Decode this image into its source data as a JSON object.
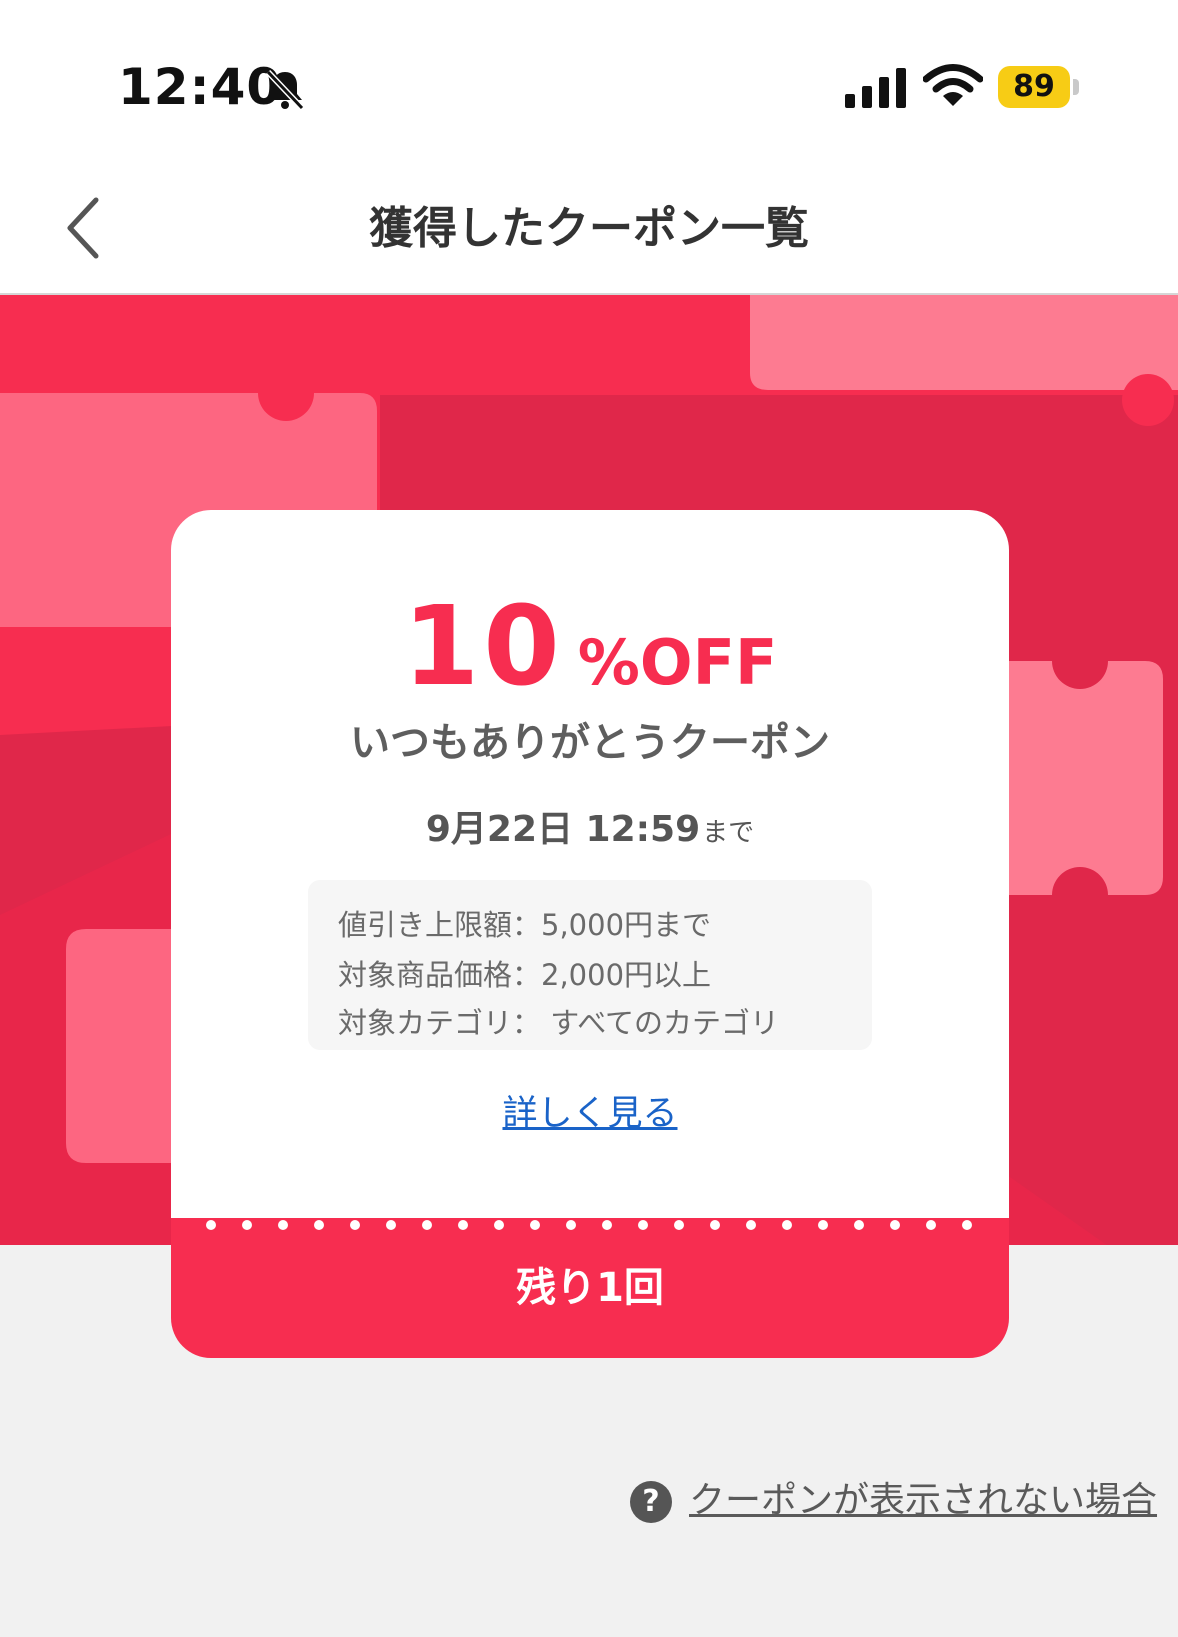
{
  "status_bar": {
    "time": "12:40",
    "battery": "89",
    "battery_color": "#f7cc15"
  },
  "header": {
    "title": "獲得したクーポン一覧",
    "back_icon": "chevron-left-icon"
  },
  "coupon": {
    "discount_value": "10",
    "discount_unit": "%OFF",
    "name": "いつもありがとうクーポン",
    "deadline_date": "9月22日 12:59",
    "deadline_suffix": "まで",
    "conditions": [
      "値引き上限額：5,000円まで",
      "対象商品価格：2,000円以上",
      "対象カテゴリ： すべてのカテゴリ"
    ],
    "details_link": "詳しく見る",
    "remaining": "残り1回",
    "accent_color": "#f72d50"
  },
  "help": {
    "icon": "question-circle-icon",
    "link": "クーポンが表示されない場合"
  }
}
